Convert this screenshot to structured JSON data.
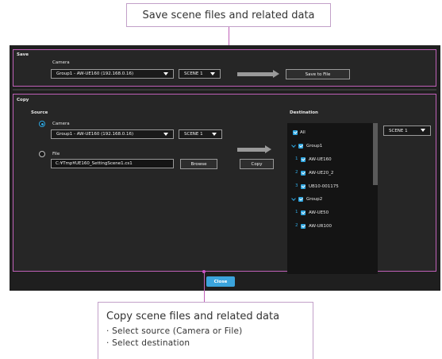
{
  "callouts": {
    "top": "Save scene files and related data",
    "bottom": {
      "title": "Copy scene files and related data",
      "items": [
        "· Select source (Camera or File)",
        "· Select destination"
      ]
    }
  },
  "save": {
    "section_title": "Save",
    "camera_label": "Camera",
    "camera_value": "Group1 - AW-UE160 (192.168.0.16)",
    "scene_value": "SCENE 1",
    "save_button": "Save to File"
  },
  "copy": {
    "section_title": "Copy",
    "source_label": "Source",
    "camera_option": "Camera",
    "camera_value": "Group1 - AW-UE160 (192.168.0.16)",
    "scene_value": "SCENE 1",
    "file_option": "File",
    "file_path": "C:¥Tmp¥UE160_SettingScene1.cs1",
    "browse_button": "Browse",
    "copy_button": "Copy",
    "destination_label": "Destination",
    "dest_scene_value": "SCENE 1",
    "all_label": "All",
    "groups": [
      {
        "name": "Group1",
        "cameras": [
          {
            "num": "1",
            "name": "AW-UE160"
          },
          {
            "num": "2",
            "name": "AW-UE20_2"
          },
          {
            "num": "3",
            "name": "UB10-001175"
          }
        ]
      },
      {
        "name": "Group2",
        "cameras": [
          {
            "num": "1",
            "name": "AW-UE50"
          },
          {
            "num": "2",
            "name": "AW-UR100"
          }
        ]
      }
    ]
  },
  "footer": {
    "close_button": "Close"
  },
  "colors": {
    "accent": "#2fa6e0",
    "callout_line": "#c060b8",
    "window_bg": "#1f1f1f"
  }
}
